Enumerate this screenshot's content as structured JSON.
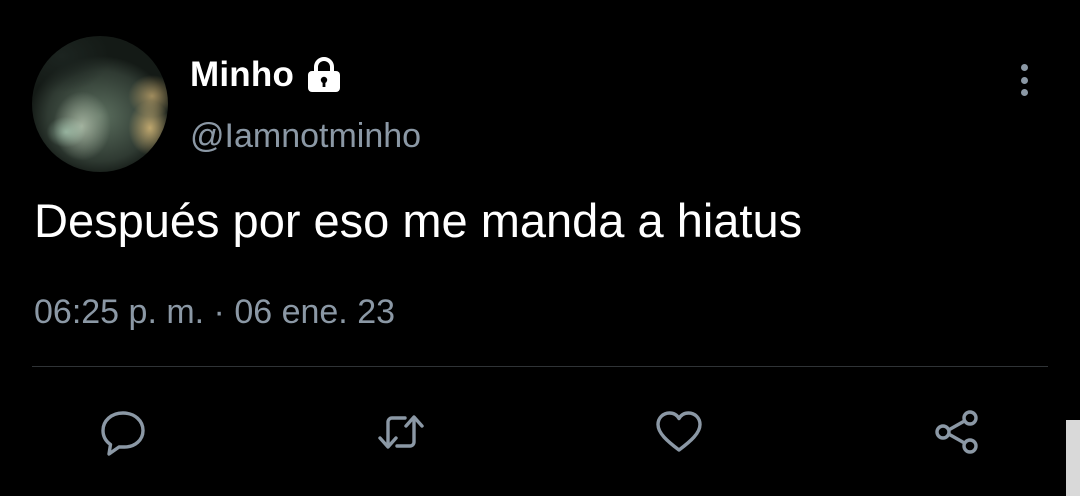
{
  "tweet": {
    "author": {
      "display_name": "Minho",
      "username": "@Iamnotminho",
      "protected_icon": "lock-icon"
    },
    "text": "Después por eso me manda a hiatus",
    "timestamp": "06:25 p. m. · 06 ene. 23",
    "actions": [
      {
        "name": "reply",
        "icon": "speech-bubble-icon"
      },
      {
        "name": "retweet",
        "icon": "retweet-icon"
      },
      {
        "name": "like",
        "icon": "heart-icon"
      },
      {
        "name": "share",
        "icon": "share-nodes-icon"
      }
    ],
    "more_menu_icon": "vertical-dots-icon"
  },
  "colors": {
    "background": "#000000",
    "primary_text": "#ffffff",
    "secondary_text": "#8b98a5",
    "divider": "#2f3336"
  }
}
